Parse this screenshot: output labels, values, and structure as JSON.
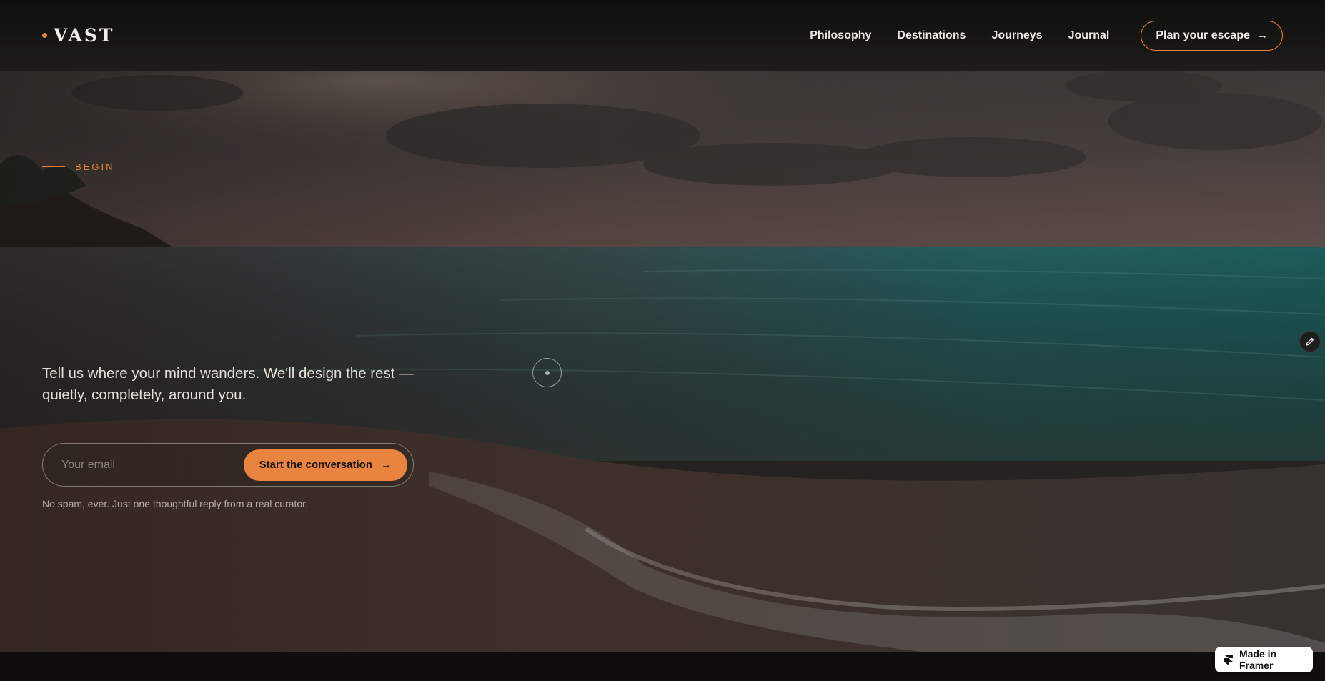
{
  "header": {
    "logo": "VAST",
    "nav": [
      "Philosophy",
      "Destinations",
      "Journeys",
      "Journal"
    ],
    "cta_label": "Plan your escape",
    "cta_icon": "arrow-right-icon"
  },
  "hero": {
    "eyebrow": "BEGIN",
    "headline": "Tell us where your mind wanders. We'll design the rest — quietly, completely, around you.",
    "form": {
      "email_placeholder": "Your email",
      "submit_label": "Start the conversation",
      "submit_icon": "arrow-right-icon"
    },
    "note": "No spam, ever. Just one thoughtful reply from a real curator."
  },
  "badge": {
    "label": "Made in Framer",
    "icon": "framer-logo-icon"
  },
  "colors": {
    "accent": "#e8843f",
    "header_bg": "#141413",
    "text": "#e8e4de"
  }
}
